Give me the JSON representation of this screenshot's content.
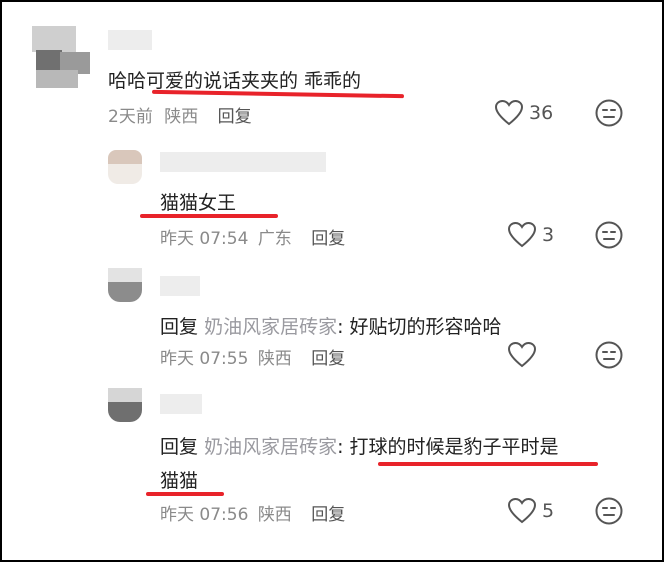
{
  "comments": [
    {
      "text": "哈哈可爱的说话夹夹的 乖乖的",
      "time": "2天前",
      "location": "陕西",
      "reply_label": "回复",
      "likes": "36"
    },
    {
      "text": "猫猫女王",
      "time": "昨天 07:54",
      "location": "广东",
      "reply_label": "回复",
      "likes": "3"
    },
    {
      "prefix": "回复",
      "mention": "奶油风家居砖家",
      "body": ": 好贴切的形容哈哈",
      "time": "昨天 07:55",
      "location": "陕西",
      "reply_label": "回复",
      "likes": ""
    },
    {
      "prefix": "回复",
      "mention": "奶油风家居砖家",
      "body": ": 打球的时候是豹子平时是",
      "body_line2": "猫猫",
      "time": "昨天 07:56",
      "location": "陕西",
      "reply_label": "回复",
      "likes": "5"
    }
  ],
  "icons": {
    "like": "heart-icon",
    "dislike": "neutral-face-icon"
  },
  "colors": {
    "annotation_underline": "#e8232a"
  }
}
